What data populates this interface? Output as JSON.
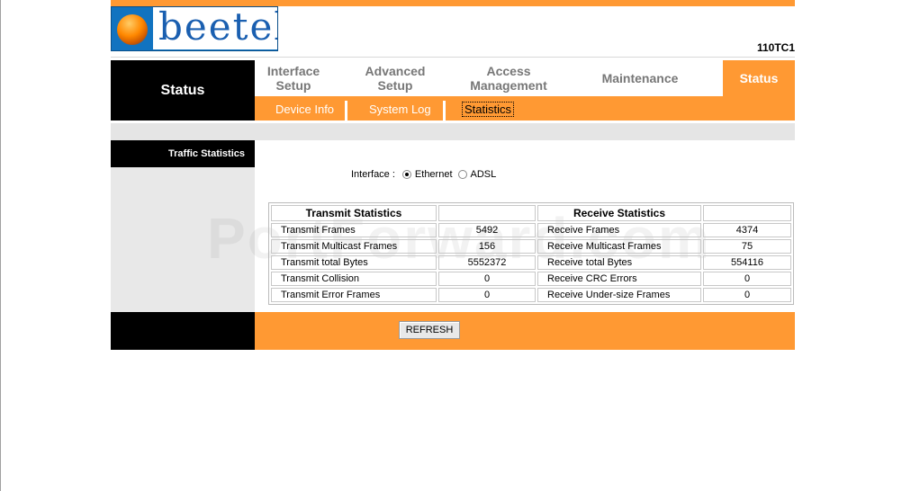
{
  "brand": {
    "logo_text": "beetel",
    "model": "110TC1"
  },
  "nav": {
    "section": "Status",
    "tabs": [
      {
        "line1": "Interface",
        "line2": "Setup"
      },
      {
        "line1": "Advanced",
        "line2": "Setup"
      },
      {
        "line1": "Access",
        "line2": "Management"
      },
      {
        "line1": "Maintenance",
        "line2": ""
      },
      {
        "line1": "Status",
        "line2": ""
      }
    ],
    "active_tab": "Status",
    "subnav": [
      "Device Info",
      "System Log",
      "Statistics"
    ],
    "active_subnav": "Statistics"
  },
  "sidebar": {
    "title": "Traffic Statistics"
  },
  "interface": {
    "label": "Interface :",
    "options": [
      "Ethernet",
      "ADSL"
    ],
    "selected": "Ethernet"
  },
  "stats": {
    "transmit_header": "Transmit Statistics",
    "receive_header": "Receive Statistics",
    "rows": [
      {
        "tx_label": "Transmit Frames",
        "tx_value": "5492",
        "rx_label": "Receive Frames",
        "rx_value": "4374"
      },
      {
        "tx_label": "Transmit Multicast Frames",
        "tx_value": "156",
        "rx_label": "Receive Multicast Frames",
        "rx_value": "75"
      },
      {
        "tx_label": "Transmit total Bytes",
        "tx_value": "5552372",
        "rx_label": "Receive total Bytes",
        "rx_value": "554116"
      },
      {
        "tx_label": "Transmit Collision",
        "tx_value": "0",
        "rx_label": "Receive CRC Errors",
        "rx_value": "0"
      },
      {
        "tx_label": "Transmit Error Frames",
        "tx_value": "0",
        "rx_label": "Receive Under-size Frames",
        "rx_value": "0"
      }
    ]
  },
  "footer": {
    "refresh_label": "REFRESH"
  },
  "watermark": "PortForward.com",
  "colors": {
    "accent": "#ff9933",
    "dark": "#000000",
    "panel": "#e8e8e8",
    "logo_blue": "#1173c0"
  }
}
